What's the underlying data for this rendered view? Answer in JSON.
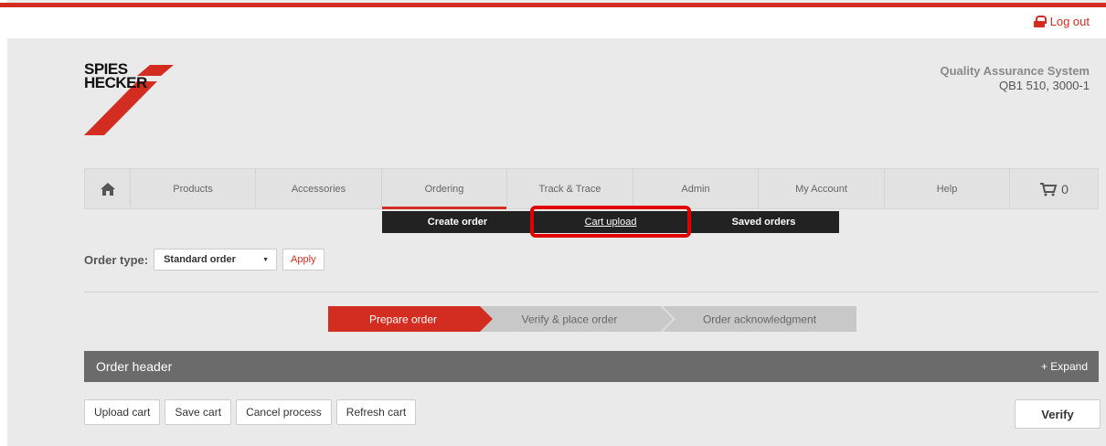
{
  "header": {
    "logout_label": "Log out",
    "logo_line1": "SPIES",
    "logo_line2": "HECKER",
    "system_title": "Quality Assurance System",
    "system_code": "QB1 510, 3000-1"
  },
  "nav": {
    "items": [
      {
        "label": "Products"
      },
      {
        "label": "Accessories"
      },
      {
        "label": "Ordering"
      },
      {
        "label": "Track & Trace"
      },
      {
        "label": "Admin"
      },
      {
        "label": "My Account"
      },
      {
        "label": "Help"
      }
    ],
    "cart_count": "0"
  },
  "subnav": {
    "items": [
      {
        "label": "Create order"
      },
      {
        "label": "Cart upload"
      },
      {
        "label": "Saved orders"
      }
    ]
  },
  "order_type": {
    "label": "Order type:",
    "selected": "Standard order",
    "apply_label": "Apply"
  },
  "steps": [
    {
      "label": "Prepare order"
    },
    {
      "label": "Verify & place order"
    },
    {
      "label": "Order acknowledgment"
    }
  ],
  "order_header": {
    "title": "Order header",
    "expand_label": "+ Expand"
  },
  "actions": {
    "upload_cart": "Upload cart",
    "save_cart": "Save cart",
    "cancel_process": "Cancel process",
    "refresh_cart": "Refresh cart",
    "verify": "Verify"
  },
  "colors": {
    "brand_red": "#d22d20",
    "header_gray": "#6b6b6b",
    "step_inactive": "#c8c8c8"
  }
}
